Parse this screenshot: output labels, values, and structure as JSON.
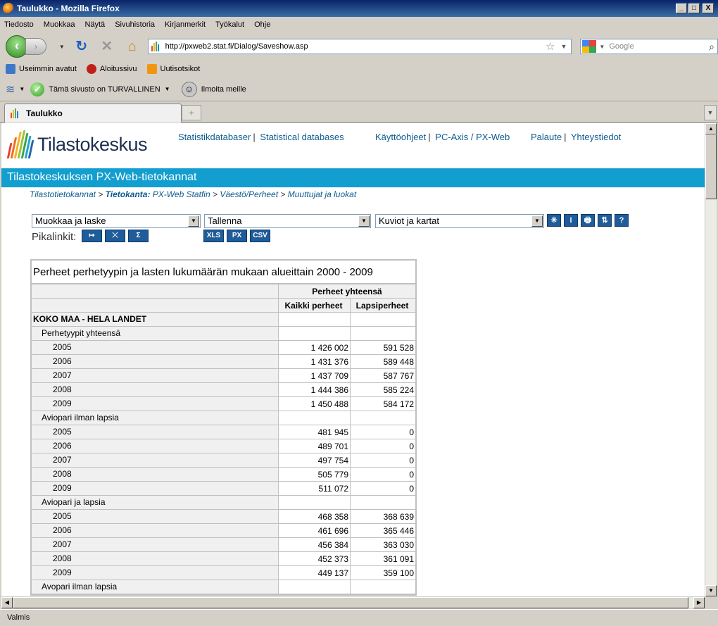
{
  "window": {
    "title": "Taulukko - Mozilla Firefox",
    "min": "_",
    "max": "□",
    "close": "X"
  },
  "menu": [
    "Tiedosto",
    "Muokkaa",
    "Näytä",
    "Sivuhistoria",
    "Kirjanmerkit",
    "Työkalut",
    "Ohje"
  ],
  "nav": {
    "url": "http://pxweb2.stat.fi/Dialog/Saveshow.asp",
    "search_placeholder": "Google"
  },
  "bookmarks": [
    "Useimmin avatut",
    "Aloitussivu",
    "Uutisotsikot"
  ],
  "addons": {
    "safe_label": "Tämä sivusto on TURVALLINEN",
    "report_label": "Ilmoita meille"
  },
  "tab": {
    "label": "Taulukko"
  },
  "status": "Valmis",
  "page": {
    "logo_text": "Tilastokeskus",
    "links": {
      "statistikdatabaser": "Statistikdatabaser",
      "statistical_databases": "Statistical databases",
      "kayttoohjeet": "Käyttöohjeet",
      "pcaxis": "PC-Axis / PX-Web",
      "palaute": "Palaute",
      "yhteystiedot": "Yhteystiedot"
    },
    "banner": "Tilastokeskuksen PX-Web-tietokannat",
    "breadcrumb": {
      "c1": "Tilastotietokannat",
      "c2_label": "Tietokanta:",
      "c2": "PX-Web Statfin",
      "c3": "Väestö/Perheet",
      "c4": "Muuttujat ja luokat",
      "sep": ">"
    },
    "selects": {
      "muokkaa": "Muokkaa ja laske",
      "tallenna": "Tallenna",
      "kuviot": "Kuviot ja kartat"
    },
    "tool_icons": [
      "✳",
      "i",
      "🖶",
      "⇅",
      "?"
    ],
    "pikalinkit_label": "Pikalinkit:",
    "quick_buttons": [
      "↦",
      "⤫",
      "Σ"
    ],
    "format_buttons": [
      "XLS",
      "PX",
      "CSV"
    ]
  },
  "table": {
    "caption": "Perheet perhetyypin ja lasten lukumäärän mukaan alueittain 2000 - 2009",
    "group_header": "Perheet yhteensä",
    "col1": "Kaikki perheet",
    "col2": "Lapsiperheet",
    "rows": [
      {
        "label": "KOKO MAA - HELA LANDET",
        "level": 0,
        "v1": "",
        "v2": ""
      },
      {
        "label": "Perhetyypit yhteensä",
        "level": 1,
        "v1": "",
        "v2": ""
      },
      {
        "label": "2005",
        "level": 2,
        "v1": "1 426 002",
        "v2": "591 528"
      },
      {
        "label": "2006",
        "level": 2,
        "v1": "1 431 376",
        "v2": "589 448"
      },
      {
        "label": "2007",
        "level": 2,
        "v1": "1 437 709",
        "v2": "587 767"
      },
      {
        "label": "2008",
        "level": 2,
        "v1": "1 444 386",
        "v2": "585 224"
      },
      {
        "label": "2009",
        "level": 2,
        "v1": "1 450 488",
        "v2": "584 172"
      },
      {
        "label": "Aviopari ilman lapsia",
        "level": 1,
        "v1": "",
        "v2": ""
      },
      {
        "label": "2005",
        "level": 2,
        "v1": "481 945",
        "v2": "0"
      },
      {
        "label": "2006",
        "level": 2,
        "v1": "489 701",
        "v2": "0"
      },
      {
        "label": "2007",
        "level": 2,
        "v1": "497 754",
        "v2": "0"
      },
      {
        "label": "2008",
        "level": 2,
        "v1": "505 779",
        "v2": "0"
      },
      {
        "label": "2009",
        "level": 2,
        "v1": "511 072",
        "v2": "0"
      },
      {
        "label": "Aviopari ja lapsia",
        "level": 1,
        "v1": "",
        "v2": ""
      },
      {
        "label": "2005",
        "level": 2,
        "v1": "468 358",
        "v2": "368 639"
      },
      {
        "label": "2006",
        "level": 2,
        "v1": "461 696",
        "v2": "365 446"
      },
      {
        "label": "2007",
        "level": 2,
        "v1": "456 384",
        "v2": "363 030"
      },
      {
        "label": "2008",
        "level": 2,
        "v1": "452 373",
        "v2": "361 091"
      },
      {
        "label": "2009",
        "level": 2,
        "v1": "449 137",
        "v2": "359 100"
      },
      {
        "label": "Avopari ilman lapsia",
        "level": 1,
        "v1": "",
        "v2": ""
      }
    ]
  }
}
